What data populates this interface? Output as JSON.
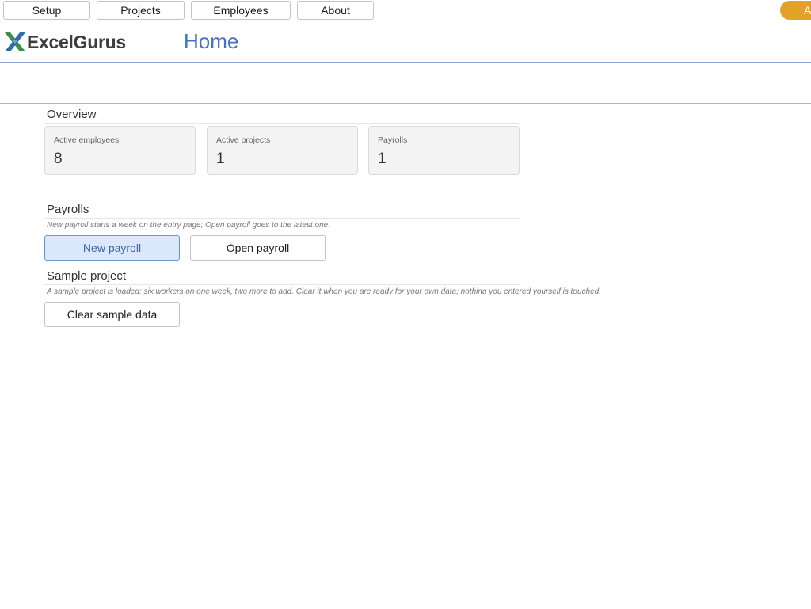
{
  "nav": {
    "items": [
      {
        "label": "Setup"
      },
      {
        "label": "Projects"
      },
      {
        "label": "Employees"
      },
      {
        "label": "About"
      }
    ],
    "corner_label": "A"
  },
  "header": {
    "logo_text": "ExcelGurus",
    "title": "Home"
  },
  "overview": {
    "title": "Overview",
    "cards": [
      {
        "label": "Active employees",
        "value": "8"
      },
      {
        "label": "Active projects",
        "value": "1"
      },
      {
        "label": "Payrolls",
        "value": "1"
      }
    ]
  },
  "payrolls": {
    "title": "Payrolls",
    "hint": "New payroll starts a week on the entry page; Open payroll goes to the latest one.",
    "new_label": "New payroll",
    "open_label": "Open payroll"
  },
  "sample": {
    "title": "Sample project",
    "hint": "A sample project is loaded: six workers on one week, two more to add. Clear it when you are ready for your own data; nothing you entered yourself is touched.",
    "clear_label": "Clear sample data"
  },
  "colors": {
    "accent": "#4472c4",
    "corner_button": "#e0a328",
    "primary_button_bg": "#dbe7fb",
    "logo_green": "#3b8f4a",
    "logo_blue": "#2a6ea8"
  }
}
